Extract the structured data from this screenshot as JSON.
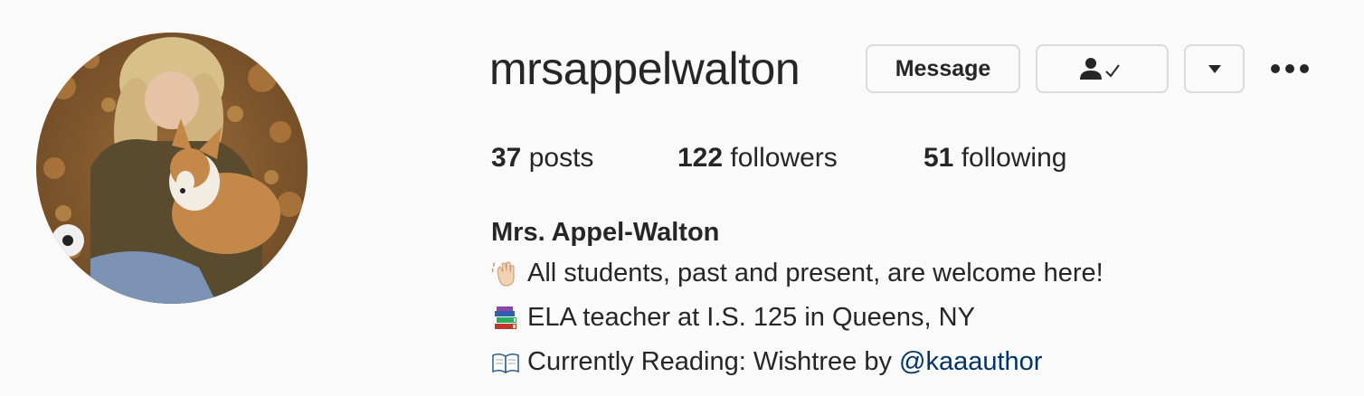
{
  "profile": {
    "username": "mrsappelwalton",
    "avatar_alt": "profile photo",
    "buttons": {
      "message_label": "Message",
      "following_icon": "person-check-icon",
      "dropdown_icon": "caret-down-icon",
      "more_icon": "ellipsis-icon"
    },
    "stats": {
      "posts_count": "37",
      "posts_label": "posts",
      "followers_count": "122",
      "followers_label": "followers",
      "following_count": "51",
      "following_label": "following"
    },
    "bio": {
      "full_name": "Mrs. Appel-Walton",
      "lines": [
        {
          "emoji": "waving-hand-icon",
          "text": "All students, past and present, are welcome here!"
        },
        {
          "emoji": "books-icon",
          "text": "ELA teacher at I.S. 125 in Queens, NY"
        },
        {
          "emoji": "open-book-icon",
          "text": "Currently Reading: Wishtree by ",
          "mention": "@kaaauthor"
        }
      ]
    },
    "colors": {
      "background": "#fafafa",
      "text": "#262626",
      "border": "#dbdbdb",
      "mention": "#003569"
    }
  }
}
